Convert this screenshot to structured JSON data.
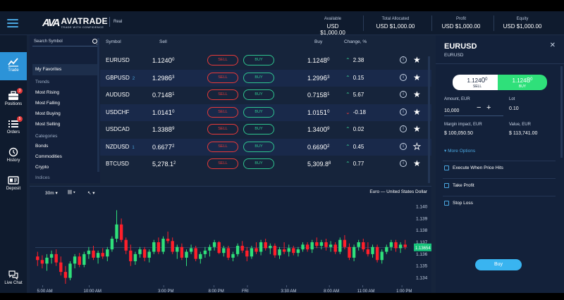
{
  "header": {
    "brand": "AVATRADE",
    "brand_mark": "AVA",
    "tagline": "TRADE WITH CONFIDENCE",
    "account_type": "Real",
    "stats": [
      {
        "label": "Available",
        "value": "USD $1,000.00"
      },
      {
        "label": "Total Allocated",
        "value": "USD $1,000.00"
      },
      {
        "label": "Profit",
        "value": "USD $1,000.00"
      },
      {
        "label": "Equity",
        "value": "USD $1,000.00"
      }
    ]
  },
  "leftnav": [
    {
      "label": "Trade",
      "icon": "trade-icon",
      "active": true,
      "badge": ""
    },
    {
      "label": "Positions",
      "icon": "briefcase-icon",
      "badge": "3"
    },
    {
      "label": "Orders",
      "icon": "list-icon",
      "badge": "5"
    },
    {
      "label": "History",
      "icon": "history-icon",
      "badge": ""
    },
    {
      "label": "Deposit",
      "icon": "id-card-icon",
      "badge": ""
    },
    {
      "label": "Live Chat",
      "icon": "chat-icon",
      "badge": ""
    }
  ],
  "market_list": {
    "search_placeholder": "Search Symbol",
    "favorites": "My Favorites",
    "trends_heading": "Trends",
    "trends": [
      "Most Rising",
      "Most Falling",
      "Most Buying",
      "Most Selling"
    ],
    "categories_heading": "Categories",
    "categories": [
      "Bonds",
      "Commodities",
      "Crypto",
      "Indices"
    ]
  },
  "table": {
    "headers": {
      "symbol": "Symbol",
      "sell": "Sell",
      "buy": "Buy",
      "change": "Change, %"
    },
    "sell_label": "SELL",
    "buy_label": "BUY",
    "rows": [
      {
        "symbol": "EURUSD",
        "count": "",
        "sell_main": "1.124",
        "sell_big": "0",
        "sell_sup": "0",
        "buy_main": "1.124",
        "buy_big": "8",
        "buy_sup": "0",
        "dir": "up",
        "change": "2.38",
        "starred": true
      },
      {
        "symbol": "GBPUSD",
        "count": "2",
        "sell_main": "1.298",
        "sell_big": "6",
        "sell_sup": "3",
        "buy_main": "1.299",
        "buy_big": "6",
        "buy_sup": "3",
        "dir": "up",
        "change": "0.15",
        "starred": true
      },
      {
        "symbol": "AUDUSD",
        "count": "",
        "sell_main": "0.714",
        "sell_big": "8",
        "sell_sup": "1",
        "buy_main": "0.715",
        "buy_big": "8",
        "buy_sup": "1",
        "dir": "up",
        "change": "5.67",
        "starred": true
      },
      {
        "symbol": "USDCHF",
        "count": "",
        "sell_main": "1.014",
        "sell_big": "1",
        "sell_sup": "0",
        "buy_main": "1.015",
        "buy_big": "1",
        "buy_sup": "0",
        "dir": "down",
        "change": "-0.18",
        "starred": true
      },
      {
        "symbol": "USDCAD",
        "count": "",
        "sell_main": "1.338",
        "sell_big": "8",
        "sell_sup": "9",
        "buy_main": "1.340",
        "buy_big": "0",
        "buy_sup": "9",
        "dir": "up",
        "change": "0.02",
        "starred": true
      },
      {
        "symbol": "NZDUSD",
        "count": "1",
        "sell_main": "0.667",
        "sell_big": "7",
        "sell_sup": "2",
        "buy_main": "0.669",
        "buy_big": "0",
        "buy_sup": "2",
        "dir": "up",
        "change": "0.45",
        "starred": false
      },
      {
        "symbol": "BTCUSD",
        "count": "",
        "sell_main": "5,278.1",
        "sell_big": "",
        "sell_sup": "2",
        "buy_main": "5,309.8",
        "buy_big": "",
        "buy_sup": "8",
        "dir": "up",
        "change": "0.77",
        "starred": true
      }
    ]
  },
  "chart": {
    "title": "Euro — United States Dollar",
    "timeframe": "30m",
    "current_price": "1.13654",
    "y_ticks": [
      "1.140",
      "1.139",
      "1.138",
      "1.137",
      "1.136",
      "1.135",
      "1.134"
    ],
    "x_ticks": [
      "5:00 AM",
      "10:00 AM",
      "3:00 PM",
      "8:00 PM",
      "FRI",
      "3:30 AM",
      "8:00 AM",
      "11:00 AM",
      "1:00 PM"
    ]
  },
  "chart_data": {
    "type": "candlestick",
    "title": "Euro — United States Dollar",
    "ylim": [
      1.1335,
      1.1405
    ],
    "current": 1.13654,
    "x_labels": [
      "5:00 AM",
      "10:00 AM",
      "3:00 PM",
      "8:00 PM",
      "FRI",
      "3:30 AM",
      "8:00 AM",
      "11:00 AM",
      "1:00 PM"
    ],
    "candles": [
      [
        1.1358,
        1.1362,
        1.135,
        1.1355
      ],
      [
        1.1355,
        1.1359,
        1.1348,
        1.1352
      ],
      [
        1.1352,
        1.136,
        1.1346,
        1.1357
      ],
      [
        1.1357,
        1.1363,
        1.1352,
        1.136
      ],
      [
        1.136,
        1.1364,
        1.135,
        1.1353
      ],
      [
        1.1353,
        1.1358,
        1.1342,
        1.1345
      ],
      [
        1.1345,
        1.135,
        1.1335,
        1.134
      ],
      [
        1.134,
        1.1354,
        1.1338,
        1.1352
      ],
      [
        1.1352,
        1.136,
        1.1348,
        1.1358
      ],
      [
        1.1358,
        1.1361,
        1.1349,
        1.1351
      ],
      [
        1.1351,
        1.1362,
        1.1349,
        1.136
      ],
      [
        1.136,
        1.1366,
        1.1356,
        1.1363
      ],
      [
        1.1363,
        1.1367,
        1.1355,
        1.1357
      ],
      [
        1.1357,
        1.1363,
        1.1352,
        1.1361
      ],
      [
        1.1361,
        1.1365,
        1.1356,
        1.1358
      ],
      [
        1.1358,
        1.1366,
        1.1354,
        1.1364
      ],
      [
        1.1364,
        1.1375,
        1.1362,
        1.1373
      ],
      [
        1.1373,
        1.1397,
        1.137,
        1.1385
      ],
      [
        1.1385,
        1.139,
        1.137,
        1.1372
      ],
      [
        1.1372,
        1.1374,
        1.136,
        1.1363
      ],
      [
        1.1363,
        1.1368,
        1.135,
        1.1354
      ],
      [
        1.1354,
        1.1362,
        1.1351,
        1.136
      ],
      [
        1.136,
        1.1366,
        1.1357,
        1.1364
      ],
      [
        1.1364,
        1.1366,
        1.1354,
        1.1357
      ],
      [
        1.1357,
        1.1364,
        1.1353,
        1.1362
      ],
      [
        1.1362,
        1.1372,
        1.136,
        1.137
      ],
      [
        1.137,
        1.1374,
        1.136,
        1.1362
      ],
      [
        1.1362,
        1.1375,
        1.136,
        1.1373
      ],
      [
        1.1373,
        1.1379,
        1.1369,
        1.1371
      ],
      [
        1.1371,
        1.1374,
        1.136,
        1.1362
      ],
      [
        1.1362,
        1.1368,
        1.1356,
        1.1366
      ],
      [
        1.1366,
        1.1369,
        1.1355,
        1.1357
      ],
      [
        1.1357,
        1.1364,
        1.135,
        1.1362
      ],
      [
        1.1362,
        1.1368,
        1.136,
        1.1365
      ],
      [
        1.1365,
        1.1367,
        1.1354,
        1.1356
      ],
      [
        1.1356,
        1.1362,
        1.1352,
        1.136
      ],
      [
        1.136,
        1.1366,
        1.1357,
        1.1363
      ],
      [
        1.1363,
        1.1368,
        1.1358,
        1.1366
      ],
      [
        1.1366,
        1.1372,
        1.1363,
        1.137
      ],
      [
        1.137,
        1.1371,
        1.136,
        1.1361
      ],
      [
        1.1361,
        1.1367,
        1.1358,
        1.1365
      ],
      [
        1.1365,
        1.1367,
        1.1355,
        1.1357
      ],
      [
        1.1357,
        1.1362,
        1.1354,
        1.136
      ],
      [
        1.136,
        1.1369,
        1.1358,
        1.1367
      ],
      [
        1.1367,
        1.1371,
        1.1361,
        1.1363
      ],
      [
        1.1363,
        1.1366,
        1.1354,
        1.1358
      ],
      [
        1.1358,
        1.1367,
        1.1356,
        1.1365
      ],
      [
        1.1365,
        1.137,
        1.136,
        1.1362
      ],
      [
        1.1362,
        1.1372,
        1.1359,
        1.137
      ],
      [
        1.137,
        1.1373,
        1.1363,
        1.1365
      ],
      [
        1.1365,
        1.1369,
        1.136,
        1.1367
      ],
      [
        1.1367,
        1.1369,
        1.1357,
        1.1359
      ],
      [
        1.1359,
        1.1366,
        1.1356,
        1.1364
      ],
      [
        1.1364,
        1.137,
        1.136,
        1.1362
      ],
      [
        1.1362,
        1.1368,
        1.1358,
        1.1365
      ],
      [
        1.1365,
        1.1367,
        1.1359,
        1.1361
      ],
      [
        1.1361,
        1.1366,
        1.1358,
        1.1364
      ],
      [
        1.1364,
        1.137,
        1.1362,
        1.1368
      ],
      [
        1.1368,
        1.137,
        1.1362,
        1.1364
      ],
      [
        1.1364,
        1.1372,
        1.1361,
        1.137
      ],
      [
        1.137,
        1.1374,
        1.1365,
        1.1367
      ],
      [
        1.1367,
        1.1372,
        1.1364,
        1.137
      ],
      [
        1.137,
        1.1373,
        1.1363,
        1.1366
      ],
      [
        1.1366,
        1.1371,
        1.1362,
        1.1368
      ],
      [
        1.1368,
        1.137,
        1.136,
        1.1362
      ],
      [
        1.1362,
        1.1374,
        1.136,
        1.1372
      ],
      [
        1.1372,
        1.1376,
        1.1364,
        1.1366
      ],
      [
        1.1366,
        1.1369,
        1.1355,
        1.1357
      ],
      [
        1.1357,
        1.1368,
        1.1354,
        1.1366
      ],
      [
        1.1366,
        1.1372,
        1.1363,
        1.137
      ],
      [
        1.137,
        1.1373,
        1.1362,
        1.1364
      ],
      [
        1.1364,
        1.137,
        1.1358,
        1.136
      ],
      [
        1.136,
        1.1368,
        1.1357,
        1.1366
      ],
      [
        1.1366,
        1.1368,
        1.1353,
        1.1355
      ],
      [
        1.1355,
        1.1364,
        1.1352,
        1.1362
      ],
      [
        1.1362,
        1.1368,
        1.136,
        1.1366
      ],
      [
        1.1366,
        1.1372,
        1.1363,
        1.137
      ],
      [
        1.137,
        1.1372,
        1.1362,
        1.1365
      ],
      [
        1.1365,
        1.137,
        1.1361,
        1.1368
      ],
      [
        1.1368,
        1.1372,
        1.1364,
        1.1366
      ]
    ]
  },
  "trade_panel": {
    "symbol": "EURUSD",
    "symbol_sub": "EURUSD",
    "sell_price_main": "1.124",
    "sell_price_big": "0",
    "sell_price_sup": "0",
    "sell_label": "SELL",
    "buy_price_main": "1.124",
    "buy_price_big": "8",
    "buy_price_sup": "0",
    "buy_label": "BUY",
    "amount_label": "Amount, EUR",
    "amount_value": "10,000",
    "lot_label": "Lot",
    "lot_value": "0.10",
    "margin_label": "Margin impact, EUR",
    "margin_value": "$ 100,050.50",
    "value_label": "Value, EUR",
    "value_value": "$ 113,741.00",
    "more_options": "More Options",
    "options": [
      "Execute When Price Hits",
      "Take Profit",
      "Stop Loss"
    ],
    "buy_button": "Buy"
  },
  "colors": {
    "sell": "#e83a3a",
    "buy": "#2fc48f",
    "accent": "#2c93d8",
    "background": "#16243b"
  }
}
